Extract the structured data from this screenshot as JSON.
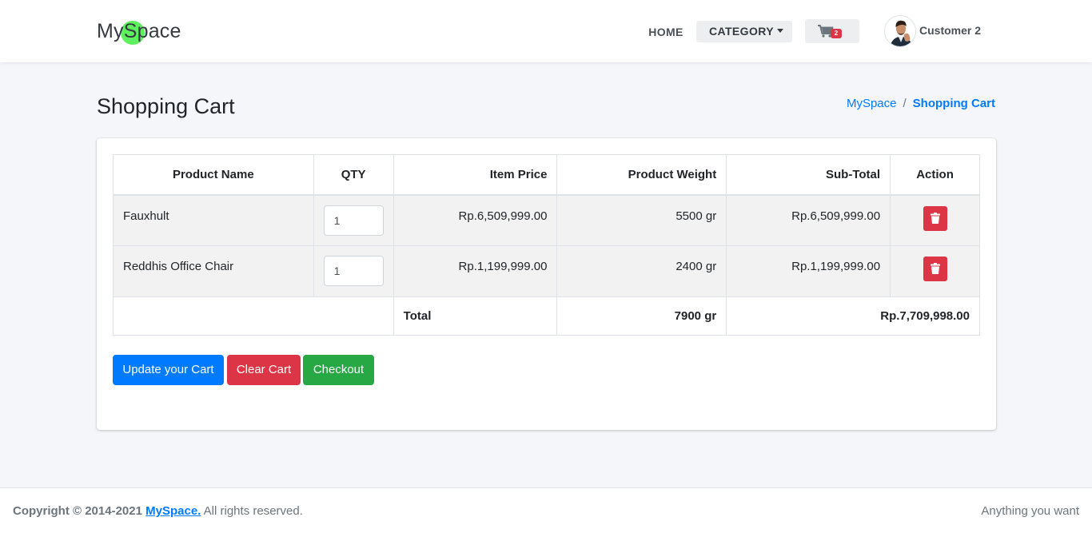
{
  "navbar": {
    "brand": "MySpace",
    "home": "HOME",
    "category": "CATEGORY",
    "cart_count": "2",
    "user_name": "Customer 2"
  },
  "header": {
    "title": "Shopping Cart",
    "breadcrumb": [
      "MySpace",
      "Shopping Cart"
    ]
  },
  "table": {
    "columns": [
      "Product Name",
      "QTY",
      "Item Price",
      "Product Weight",
      "Sub-Total",
      "Action"
    ],
    "rows": [
      {
        "name": "Fauxhult",
        "qty": "1",
        "price": "Rp.6,509,999.00",
        "weight": "5500 gr",
        "subtotal": "Rp.6,509,999.00"
      },
      {
        "name": "Reddhis Office Chair",
        "qty": "1",
        "price": "Rp.1,199,999.00",
        "weight": "2400 gr",
        "subtotal": "Rp.1,199,999.00"
      }
    ],
    "total_label": "Total",
    "total_weight": "7900 gr",
    "total_amount": "Rp.7,709,998.00"
  },
  "buttons": {
    "update": "Update your Cart",
    "clear": "Clear Cart",
    "checkout": "Checkout"
  },
  "footer": {
    "copyright_prefix": "Copyright © 2014-2021",
    "brand": "MySpace.",
    "suffix": "All rights reserved.",
    "tagline": "Anything you want"
  },
  "colors": {
    "primary": "#007bff",
    "danger": "#dc3545",
    "success": "#28a745",
    "brand_dot": "#5ef05e"
  }
}
